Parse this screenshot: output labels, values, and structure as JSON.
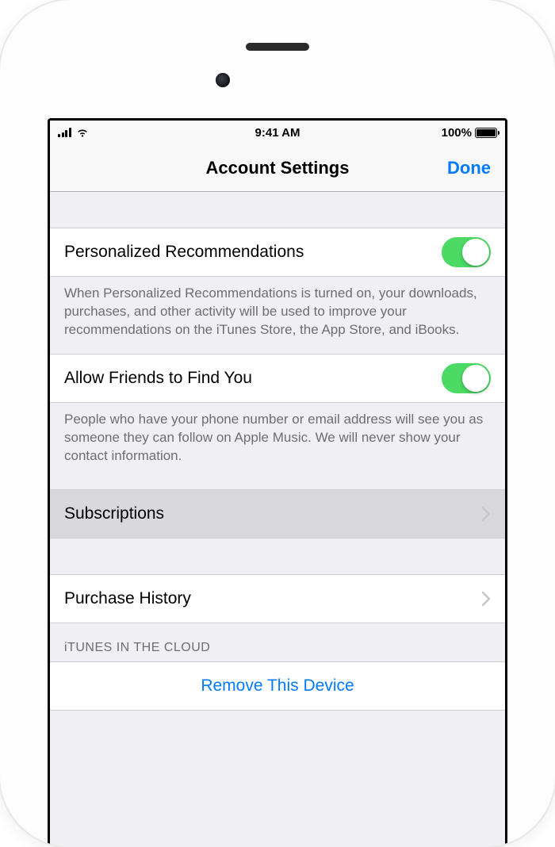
{
  "status_bar": {
    "time": "9:41 AM",
    "battery_percent": "100%"
  },
  "nav": {
    "title": "Account Settings",
    "done_label": "Done"
  },
  "rows": {
    "personalized": {
      "label": "Personalized Recommendations",
      "footer": "When Personalized Recommendations is turned on, your downloads, purchases, and other activity will be used to improve your recommendations on the iTunes Store, the App Store, and iBooks.",
      "on": true
    },
    "friends": {
      "label": "Allow Friends to Find You",
      "footer": "People who have your phone number or email address will see you as someone they can follow on Apple Music. We will never show your contact information.",
      "on": true
    },
    "subscriptions": {
      "label": "Subscriptions"
    },
    "purchase_history": {
      "label": "Purchase History"
    },
    "cloud_section_header": "iTUNES IN THE CLOUD",
    "remove_device": {
      "label": "Remove This Device"
    }
  }
}
